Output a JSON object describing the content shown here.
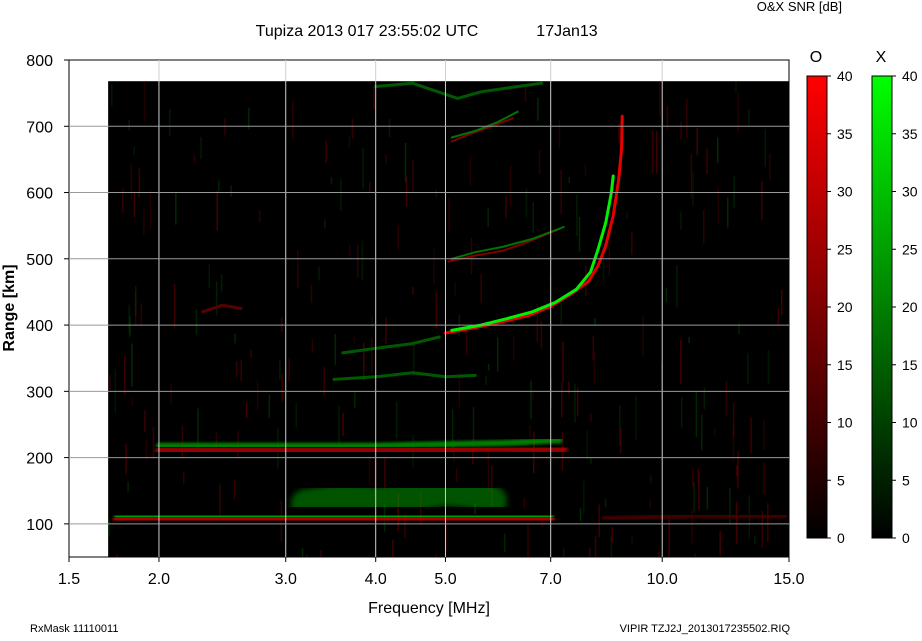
{
  "header": {
    "title": "Tupiza 2013 017 23:55:02 UTC",
    "date": "17Jan13",
    "colorbar_caption": "O&X SNR [dB]"
  },
  "footer": {
    "left": "RxMask 11110011",
    "right": "VIPIR  TZJ2J_2013017235502.RIQ"
  },
  "colors": {
    "background": "#000000",
    "o_mode": "#ff0000",
    "x_mode": "#00ff00",
    "grid": "#ffffff"
  },
  "colorbars": [
    {
      "label": "O",
      "color": "#ff0000",
      "ticks": [
        "40",
        "35",
        "30",
        "25",
        "20",
        "15",
        "10",
        "5",
        "0"
      ]
    },
    {
      "label": "X",
      "color": "#00ff00",
      "ticks": [
        "40",
        "35",
        "30",
        "25",
        "20",
        "15",
        "10",
        "5",
        "0"
      ]
    }
  ],
  "chart_data": {
    "type": "heatmap",
    "xlabel": "Frequency [MHz]",
    "ylabel": "Range [km]",
    "x_scale": "log",
    "xlim": [
      1.5,
      15.0
    ],
    "ylim": [
      50,
      800
    ],
    "x_ticks": [
      1.5,
      2.0,
      3.0,
      4.0,
      5.0,
      7.0,
      10.0,
      15.0
    ],
    "x_tick_labels": [
      "1.5",
      "2.0",
      "3.0",
      "4.0",
      "5.0",
      "7.0",
      "10.0",
      "15.0"
    ],
    "y_ticks": [
      100,
      200,
      300,
      400,
      500,
      600,
      700,
      800
    ],
    "y_tick_labels": [
      "100",
      "200",
      "300",
      "400",
      "500",
      "600",
      "700",
      "800"
    ],
    "grid": true,
    "data_extent": {
      "freq_min": 1.7,
      "range_max": 768
    },
    "snr_range": [
      0,
      40
    ],
    "series": [
      {
        "name": "O",
        "traces": [
          {
            "kind": "band",
            "points": [
              [
                1.75,
                107
              ],
              [
                2.2,
                106
              ],
              [
                3.0,
                106
              ],
              [
                4.0,
                106
              ],
              [
                5.0,
                106
              ],
              [
                6.0,
                106
              ],
              [
                7.0,
                108
              ]
            ],
            "width": 9,
            "snr": 30
          },
          {
            "kind": "band",
            "points": [
              [
                2.0,
                210
              ],
              [
                3.0,
                210
              ],
              [
                4.0,
                210
              ],
              [
                5.0,
                212
              ],
              [
                5.9,
                214
              ],
              [
                6.3,
                213
              ],
              [
                7.3,
                213
              ]
            ],
            "width": 8,
            "snr": 26
          },
          {
            "kind": "band",
            "points": [
              [
                8.3,
                108
              ],
              [
                9.5,
                110
              ],
              [
                11.0,
                112
              ],
              [
                14.8,
                112
              ]
            ],
            "width": 5,
            "snr": 12
          },
          {
            "kind": "trace",
            "points": [
              [
                5.0,
                388
              ],
              [
                5.5,
                396
              ],
              [
                6.0,
                405
              ],
              [
                6.5,
                414
              ],
              [
                7.0,
                428
              ],
              [
                7.5,
                448
              ],
              [
                7.9,
                466
              ],
              [
                8.15,
                490
              ],
              [
                8.35,
                520
              ],
              [
                8.55,
                565
              ],
              [
                8.7,
                620
              ],
              [
                8.78,
                665
              ],
              [
                8.8,
                715
              ]
            ],
            "width": 3,
            "snr": 36
          },
          {
            "kind": "trace",
            "points": [
              [
                5.05,
                496
              ],
              [
                5.5,
                505
              ],
              [
                6.0,
                512
              ],
              [
                6.5,
                525
              ],
              [
                7.2,
                545
              ]
            ],
            "width": 2,
            "snr": 20
          },
          {
            "kind": "trace",
            "points": [
              [
                5.1,
                677
              ],
              [
                5.4,
                688
              ],
              [
                5.8,
                700
              ],
              [
                6.2,
                712
              ]
            ],
            "width": 2,
            "snr": 20
          },
          {
            "kind": "trace",
            "points": [
              [
                2.3,
                420
              ],
              [
                2.45,
                430
              ],
              [
                2.6,
                425
              ]
            ],
            "width": 3,
            "snr": 14
          }
        ]
      },
      {
        "name": "X",
        "traces": [
          {
            "kind": "band",
            "points": [
              [
                1.75,
                110
              ],
              [
                2.2,
                110
              ],
              [
                3.0,
                110
              ],
              [
                4.0,
                110
              ],
              [
                5.0,
                110
              ],
              [
                6.0,
                110
              ],
              [
                7.0,
                112
              ]
            ],
            "width": 7,
            "snr": 28
          },
          {
            "kind": "band",
            "points": [
              [
                2.0,
                218
              ],
              [
                3.0,
                218
              ],
              [
                4.0,
                218
              ],
              [
                5.0,
                220
              ],
              [
                6.0,
                222
              ],
              [
                7.2,
                226
              ]
            ],
            "width": 6,
            "snr": 22
          },
          {
            "kind": "cluster",
            "points": [
              [
                3.2,
                130
              ],
              [
                3.6,
                138
              ],
              [
                4.0,
                134
              ],
              [
                4.5,
                140
              ],
              [
                5.0,
                150
              ],
              [
                5.5,
                145
              ],
              [
                5.8,
                135
              ]
            ],
            "width": 30,
            "snr": 24
          },
          {
            "kind": "trace",
            "points": [
              [
                5.1,
                392
              ],
              [
                5.6,
                400
              ],
              [
                6.1,
                410
              ],
              [
                6.6,
                420
              ],
              [
                7.1,
                434
              ],
              [
                7.6,
                454
              ],
              [
                7.95,
                480
              ],
              [
                8.15,
                515
              ],
              [
                8.35,
                555
              ],
              [
                8.5,
                600
              ],
              [
                8.55,
                625
              ]
            ],
            "width": 3,
            "snr": 38
          },
          {
            "kind": "trace",
            "points": [
              [
                5.1,
                500
              ],
              [
                5.5,
                510
              ],
              [
                6.0,
                518
              ],
              [
                6.6,
                530
              ],
              [
                7.3,
                548
              ]
            ],
            "width": 2,
            "snr": 18
          },
          {
            "kind": "trace",
            "points": [
              [
                5.1,
                683
              ],
              [
                5.5,
                693
              ],
              [
                5.9,
                706
              ],
              [
                6.3,
                722
              ]
            ],
            "width": 2,
            "snr": 18
          },
          {
            "kind": "trace",
            "points": [
              [
                3.5,
                318
              ],
              [
                4.0,
                322
              ],
              [
                4.5,
                328
              ],
              [
                5.0,
                322
              ],
              [
                5.5,
                324
              ]
            ],
            "width": 3,
            "snr": 14
          },
          {
            "kind": "trace",
            "points": [
              [
                3.6,
                358
              ],
              [
                4.0,
                365
              ],
              [
                4.5,
                372
              ],
              [
                4.9,
                382
              ]
            ],
            "width": 3,
            "snr": 14
          },
          {
            "kind": "trace",
            "points": [
              [
                4.0,
                760
              ],
              [
                4.5,
                765
              ],
              [
                5.2,
                742
              ],
              [
                5.6,
                752
              ],
              [
                6.3,
                760
              ],
              [
                6.8,
                765
              ]
            ],
            "width": 3,
            "snr": 14
          }
        ]
      }
    ]
  }
}
